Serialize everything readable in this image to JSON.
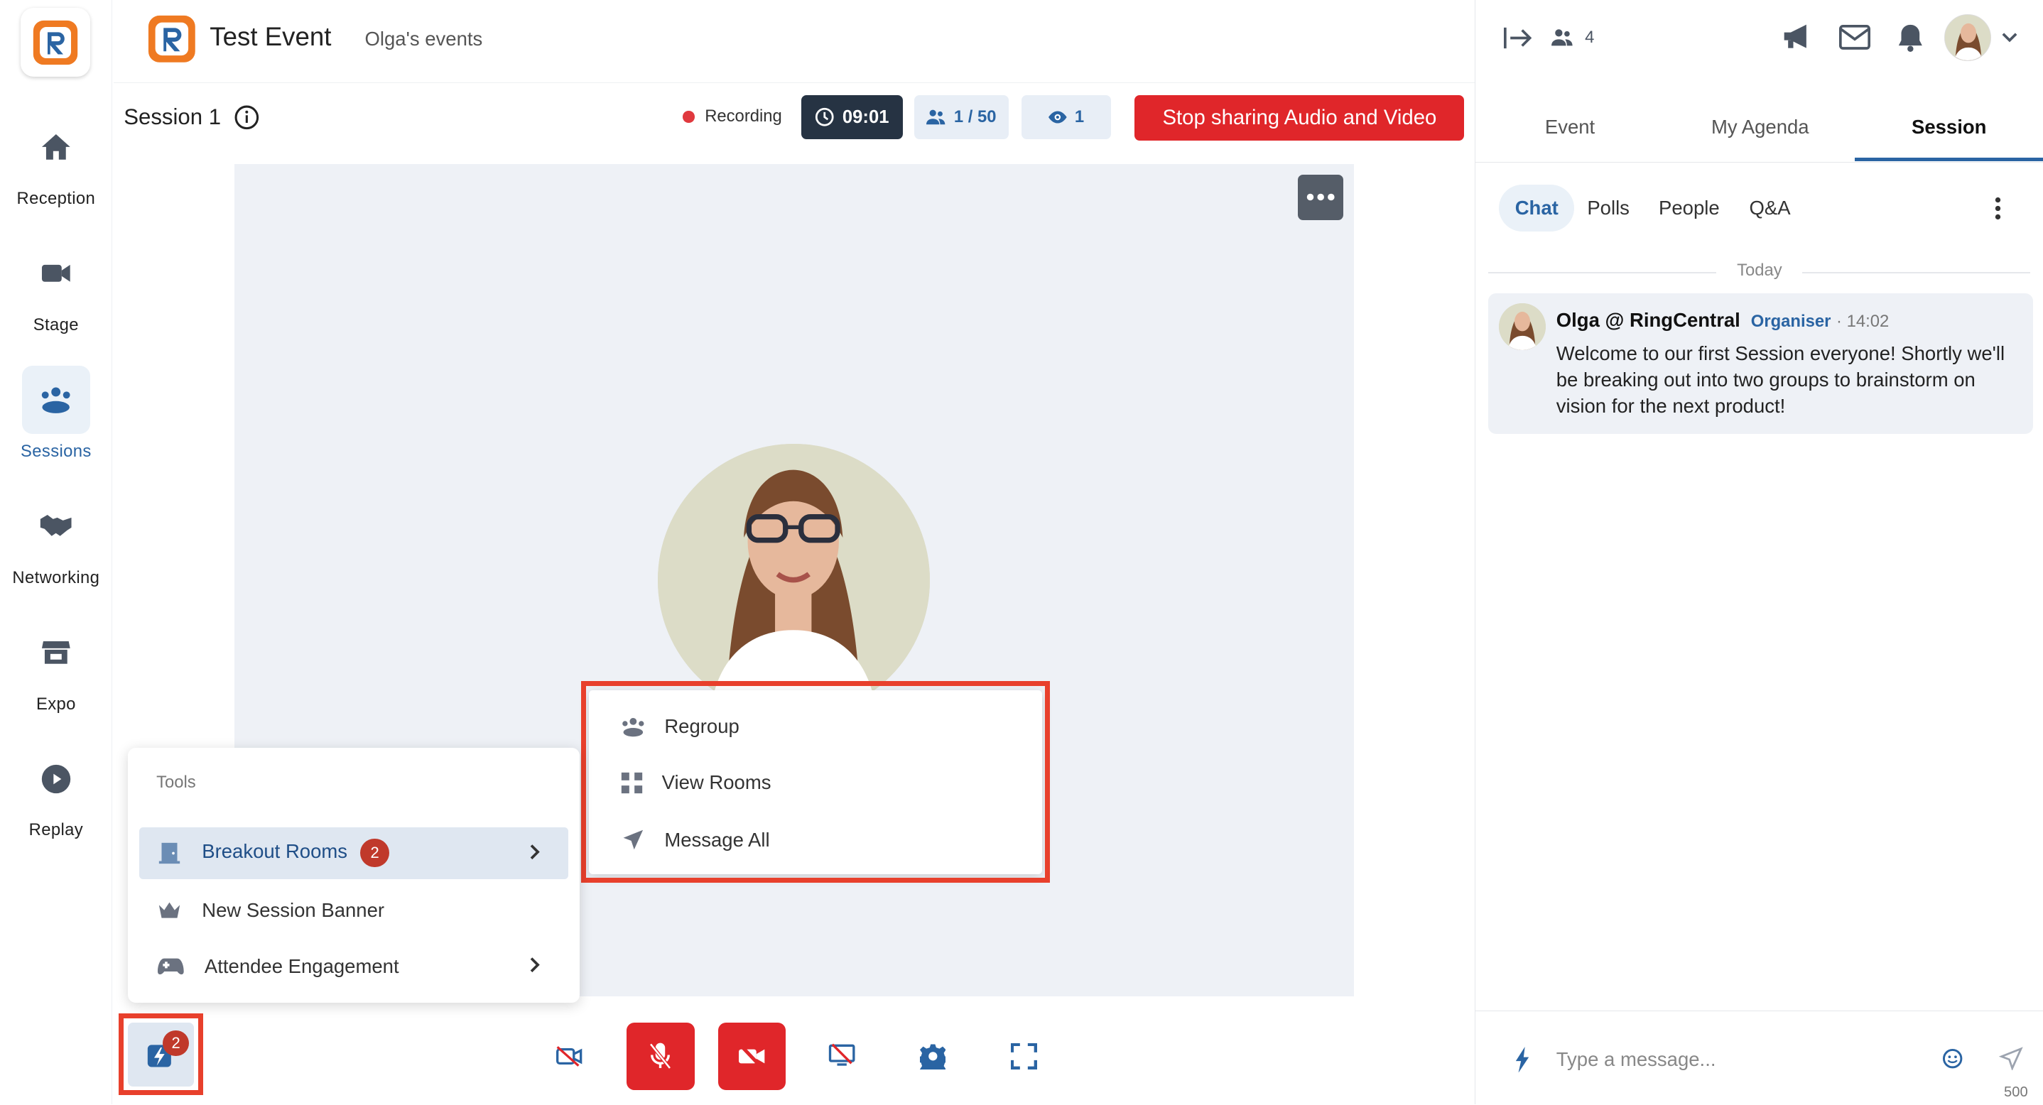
{
  "nav": {
    "items": [
      {
        "label": "Reception",
        "icon": "home-icon"
      },
      {
        "label": "Stage",
        "icon": "video-camera-icon"
      },
      {
        "label": "Sessions",
        "icon": "group-icon",
        "active": true
      },
      {
        "label": "Networking",
        "icon": "handshake-icon"
      },
      {
        "label": "Expo",
        "icon": "store-icon"
      },
      {
        "label": "Replay",
        "icon": "play-icon"
      }
    ]
  },
  "header": {
    "title": "Test Event",
    "subtitle": "Olga's events"
  },
  "session": {
    "title": "Session 1",
    "recording_label": "Recording",
    "timer": "09:01",
    "attendees": "1 / 50",
    "viewers": "1",
    "stop_label": "Stop sharing Audio and Video"
  },
  "context_menu": {
    "items": [
      {
        "label": "Regroup",
        "icon": "regroup-icon"
      },
      {
        "label": "View Rooms",
        "icon": "grid-icon"
      },
      {
        "label": "Message All",
        "icon": "send-icon"
      }
    ]
  },
  "tools": {
    "heading": "Tools",
    "items": [
      {
        "label": "Breakout Rooms",
        "badge": "2",
        "icon": "door-icon"
      },
      {
        "label": "New Session Banner",
        "icon": "crown-icon"
      },
      {
        "label": "Attendee Engagement",
        "icon": "gamepad-icon"
      }
    ],
    "button_badge": "2"
  },
  "right_panel": {
    "attendee_count": "4",
    "tabs": [
      "Event",
      "My Agenda",
      "Session"
    ],
    "active_tab": "Session",
    "subtabs": [
      "Chat",
      "Polls",
      "People",
      "Q&A"
    ],
    "active_subtab": "Chat",
    "date_divider": "Today",
    "messages": [
      {
        "author": "Olga @ RingCentral",
        "role": "Organiser",
        "time": "· 14:02",
        "text": "Welcome to our first Session everyone! Shortly we'll be breaking out into two groups to brainstorm on vision for the next product!"
      }
    ],
    "composer": {
      "placeholder": "Type a message...",
      "char_limit": "500"
    }
  },
  "colors": {
    "accent": "#2a64a3",
    "danger": "#e0262a",
    "highlight": "#e8402c",
    "brand_orange": "#ef7a22"
  }
}
